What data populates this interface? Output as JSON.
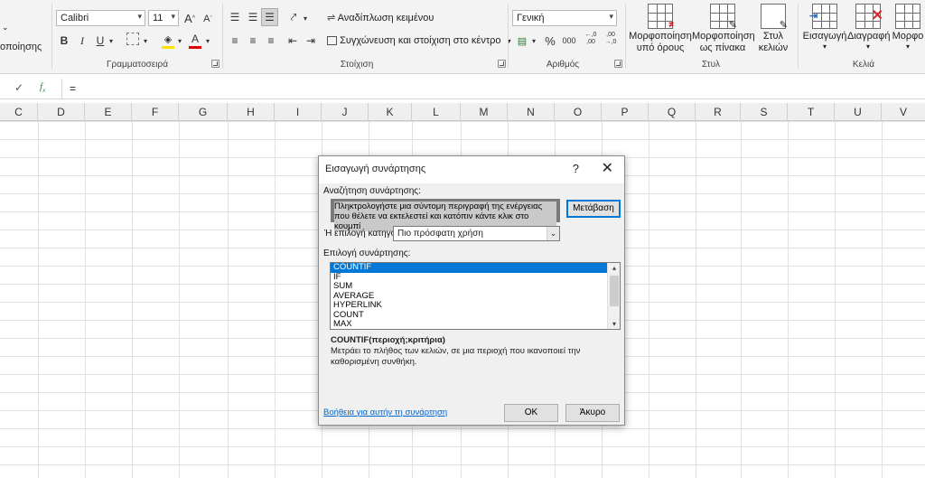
{
  "ribbon": {
    "partial_label": "οποίησης",
    "font": {
      "family": "Calibri",
      "size": "11",
      "bold": "B",
      "italic": "I",
      "underline": "U",
      "font_color_glyph": "A",
      "highlight_color": "#ffe100",
      "font_color": "#e00000",
      "group_label": "Γραμματοσειρά"
    },
    "alignment": {
      "wrap_text": "Αναδίπλωση κειμένου",
      "merge_center": "Συγχώνευση και στοίχιση στο κέντρο",
      "group_label": "Στοίχιση"
    },
    "number": {
      "format": "Γενική",
      "percent": "%",
      "thousands": "000",
      "inc_decimal": "←,0\n,00",
      "dec_decimal": ",00\n→,0",
      "group_label": "Αριθμός"
    },
    "styles": {
      "conditional": "Μορφοποίηση\nυπό όρους",
      "as_table": "Μορφοποίηση\nως πίνακα",
      "cell_styles": "Στυλ\nκελιών",
      "group_label": "Στυλ"
    },
    "cells": {
      "insert": "Εισαγωγή",
      "delete": "Διαγραφή",
      "format": "Μορφο",
      "group_label": "Κελιά"
    }
  },
  "formula_bar": {
    "value": "="
  },
  "columns": [
    "C",
    "D",
    "E",
    "F",
    "G",
    "H",
    "I",
    "J",
    "K",
    "L",
    "M",
    "N",
    "O",
    "P",
    "Q",
    "R",
    "S",
    "T",
    "U",
    "V"
  ],
  "dialog": {
    "title": "Εισαγωγή συνάρτησης",
    "help": "?",
    "close": "✕",
    "search_label": "Αναζήτηση συνάρτησης:",
    "search_text_line1": "Πληκτρολογήστε μια σύντομη περιγραφή της ενέργειας",
    "search_text_line2": "που θέλετε να εκτελεστεί και κατόπιν κάντε κλικ στο κουμπί",
    "go_button": "Μετάβαση",
    "category_label": "Ή επιλογή κατηγορίας:",
    "category_value": "Πιο πρόσφατη χρήση",
    "function_label": "Επιλογή συνάρτησης:",
    "functions": [
      "COUNTIF",
      "IF",
      "SUM",
      "AVERAGE",
      "HYPERLINK",
      "COUNT",
      "MAX"
    ],
    "selected_function": "COUNTIF",
    "syntax": "COUNTIF(περιοχή;κριτήρια)",
    "description": "Μετράει το πλήθος των κελιών, σε μια περιοχή που ικανοποιεί την καθορισμένη συνθήκη.",
    "help_link": "Βοήθεια για αυτήν τη συνάρτηση",
    "ok": "ΟΚ",
    "cancel": "Άκυρο"
  }
}
